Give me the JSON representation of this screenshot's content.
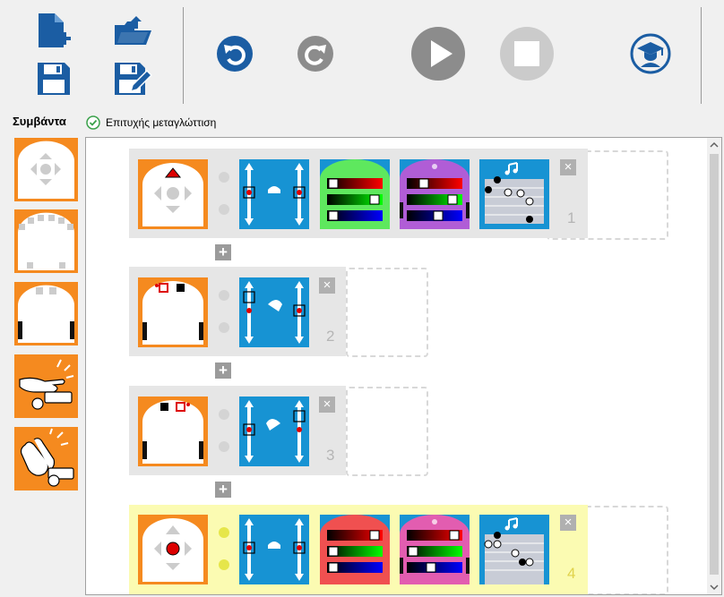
{
  "toolbar": {
    "buttons": [
      "new-file",
      "open-file",
      "save",
      "save-as",
      "undo",
      "redo",
      "run",
      "stop",
      "teacher-mode"
    ]
  },
  "sidebar": {
    "title": "Συμβάντα"
  },
  "status": {
    "text": "Επιτυχής μεταγλώττιση"
  },
  "program": {
    "rows": [
      {
        "number": "1",
        "highlighted": false
      },
      {
        "number": "2",
        "highlighted": false
      },
      {
        "number": "3",
        "highlighted": false
      },
      {
        "number": "4",
        "highlighted": true
      }
    ],
    "add_label": "+",
    "delete_label": "×"
  },
  "colors": {
    "orange": "#f58a1f",
    "blue": "#1793d3",
    "icon_blue": "#1b5da3",
    "row_gray": "#e6e6e6",
    "row_yellow": "#fbfbb2"
  }
}
